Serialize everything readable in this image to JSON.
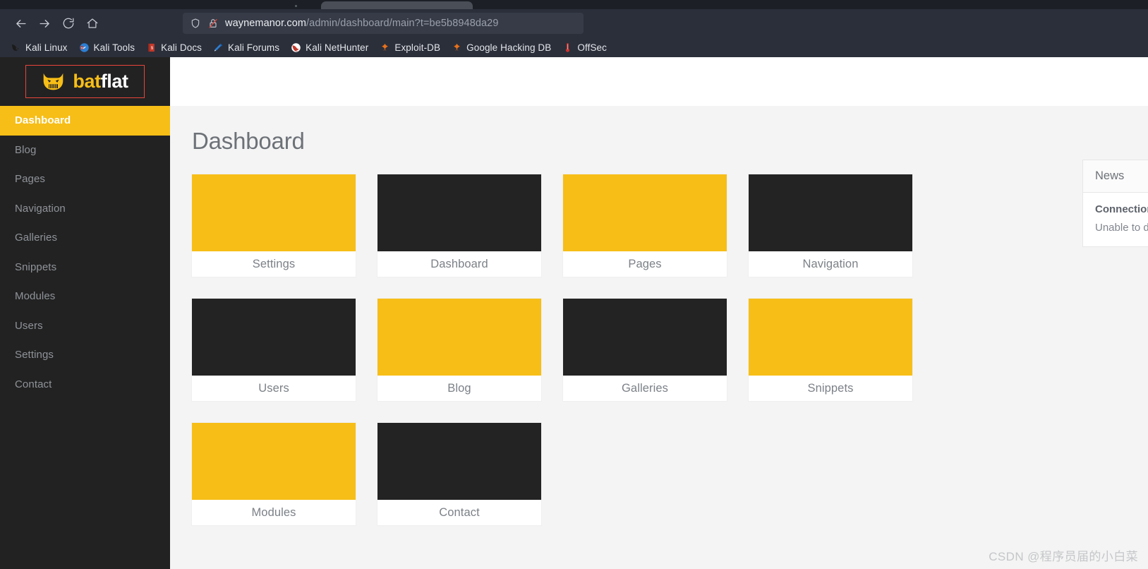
{
  "browser": {
    "nav_buttons": [
      {
        "name": "back-button",
        "icon": "arrow-left-icon"
      },
      {
        "name": "forward-button",
        "icon": "arrow-right-icon"
      },
      {
        "name": "reload-button",
        "icon": "reload-icon"
      },
      {
        "name": "home-button",
        "icon": "home-icon"
      }
    ],
    "url": {
      "host": "waynemanor.com",
      "path": "/admin/dashboard/main?t=be5b8948da29",
      "full": "waynemanor.com/admin/dashboard/main?t=be5b8948da29",
      "shield_icon": "shield-icon",
      "security_icon": "lock-crossed-icon"
    },
    "bookmarks": [
      {
        "label": "Kali Linux",
        "icon": "kali-dragon-icon"
      },
      {
        "label": "Kali Tools",
        "icon": "kali-tools-icon"
      },
      {
        "label": "Kali Docs",
        "icon": "kali-docs-icon"
      },
      {
        "label": "Kali Forums",
        "icon": "kali-forums-icon"
      },
      {
        "label": "Kali NetHunter",
        "icon": "kali-nethunter-icon"
      },
      {
        "label": "Exploit-DB",
        "icon": "exploit-db-icon"
      },
      {
        "label": "Google Hacking DB",
        "icon": "google-hacking-db-icon"
      },
      {
        "label": "OffSec",
        "icon": "offsec-icon"
      }
    ]
  },
  "sidebar": {
    "logo": {
      "part1": "bat",
      "part2": "flat",
      "icon": "batflat-bat-icon"
    },
    "items": [
      {
        "label": "Dashboard",
        "active": true
      },
      {
        "label": "Blog",
        "active": false
      },
      {
        "label": "Pages",
        "active": false
      },
      {
        "label": "Navigation",
        "active": false
      },
      {
        "label": "Galleries",
        "active": false
      },
      {
        "label": "Snippets",
        "active": false
      },
      {
        "label": "Modules",
        "active": false
      },
      {
        "label": "Users",
        "active": false
      },
      {
        "label": "Settings",
        "active": false
      },
      {
        "label": "Contact",
        "active": false
      }
    ]
  },
  "main": {
    "page_title": "Dashboard",
    "tiles": [
      {
        "label": "Settings",
        "color": "yellow"
      },
      {
        "label": "Dashboard",
        "color": "dark"
      },
      {
        "label": "Pages",
        "color": "yellow"
      },
      {
        "label": "Navigation",
        "color": "dark"
      },
      {
        "label": "Users",
        "color": "dark"
      },
      {
        "label": "Blog",
        "color": "yellow"
      },
      {
        "label": "Galleries",
        "color": "dark"
      },
      {
        "label": "Snippets",
        "color": "yellow"
      },
      {
        "label": "Modules",
        "color": "yellow"
      },
      {
        "label": "Contact",
        "color": "dark"
      }
    ]
  },
  "news": {
    "header": "News",
    "item_title": "Connection timeout",
    "item_text": "Unable to download latest news from"
  },
  "watermark": "CSDN @程序员届的小白菜",
  "colors": {
    "accent_yellow": "#f7be17",
    "sidebar_dark": "#222222",
    "tile_dark": "#232323",
    "chrome_dark": "#2b2f3a",
    "logo_border_red": "#e8443a",
    "content_bg": "#f4f4f4"
  }
}
